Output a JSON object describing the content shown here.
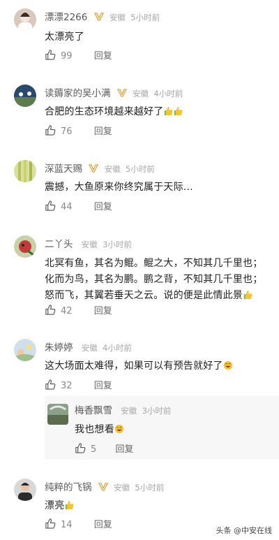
{
  "colors": {
    "badge_gold": "#d9a441",
    "like_icon": "#555555",
    "emoji_yellow": "#f4c33a",
    "emoji_green": "#7cbf4b"
  },
  "comments": [
    {
      "username": "漂漂2266",
      "location": "安徽",
      "time": "5小时前",
      "text": "太漂亮了",
      "likes": "99",
      "reply_label": "回复",
      "badge": "v-badge-icon"
    },
    {
      "username": "读薅家的吴小满",
      "location": "安徽",
      "time": "4小时前",
      "text": "合肥的生态环境越来越好了",
      "likes": "76",
      "reply_label": "回复",
      "badge": "v-badge-icon",
      "emoji": "thumbs-up-icon"
    },
    {
      "username": "深蓝天赐",
      "location": "安徽",
      "time": "5小时前",
      "text": "震撼，大鱼原来你终究属于天际...",
      "likes": "44",
      "reply_label": "回复",
      "badge": "v-badge-icon"
    },
    {
      "username": "二丫头",
      "location": "安徽",
      "time": "3小时前",
      "text": "北冥有鱼，其名为鲲。鲲之大，不知其几千里也；化而为鸟，其名为鹏。鹏之背，不知其几千里也；怒而飞，其翼若垂天之云。说的便是此情此景",
      "likes": "42",
      "reply_label": "回复",
      "emoji": "thumbs-up-icon"
    },
    {
      "username": "朱婷婷",
      "location": "安徽",
      "time": "4小时前",
      "text": "这大场面太难得，如果可以有预告就好了",
      "likes": "32",
      "reply_label": "回复",
      "emoji": "laughing-face-icon"
    },
    {
      "username": "纯粹的飞锅",
      "location": "安徽",
      "time": "5小时前",
      "text": "漂亮",
      "likes": "14",
      "reply_label": "回复",
      "badge": "v-badge-icon",
      "emoji": "thumbs-up-icon"
    }
  ],
  "reply": {
    "username": "梅香飘雪",
    "location": "安徽",
    "time": "3小时前",
    "text": "我也想看",
    "likes": "5",
    "reply_label": "回复",
    "emoji": "laughing-face-icon"
  },
  "watermark": "头条 @中安在线"
}
